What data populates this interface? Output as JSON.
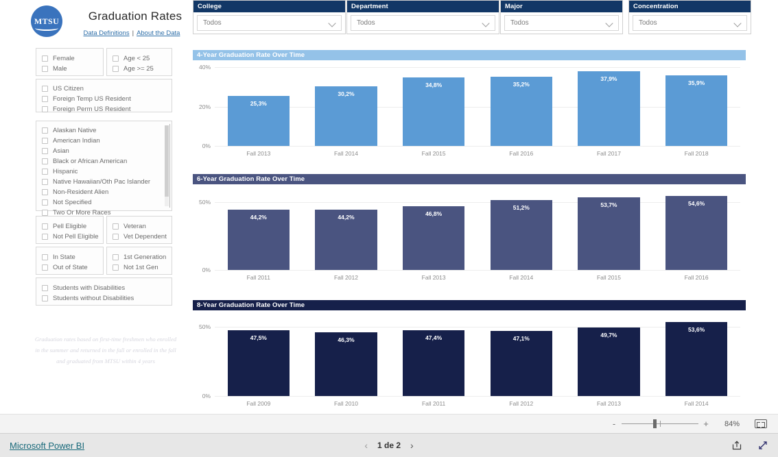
{
  "header": {
    "logo_text": "MTSU",
    "title": "Graduation Rates",
    "link_definitions": "Data Definitions",
    "link_separator": "|",
    "link_about": "About the Data"
  },
  "slicers": {
    "gender": [
      "Female",
      "Male"
    ],
    "age": [
      "Age < 25",
      "Age >= 25"
    ],
    "citizenship": [
      "US Citizen",
      "Foreign Temp US Resident",
      "Foreign Perm US Resident"
    ],
    "race": [
      "Alaskan Native",
      "American Indian",
      "Asian",
      "Black or African American",
      "Hispanic",
      "Native Hawaiian/Oth Pac Islander",
      "Non-Resident Alien",
      "Not Specified",
      "Two Or More Races"
    ],
    "pell": [
      "Pell Eligible",
      "Not Pell Eligible"
    ],
    "veteran": [
      "Veteran",
      "Vet Dependent"
    ],
    "residency": [
      "In State",
      "Out of State"
    ],
    "generation": [
      "1st Generation",
      "Not 1st Gen"
    ],
    "disability": [
      "Students with Disabilities",
      "Students without Disabilities"
    ]
  },
  "footnote": "Graduation rates based on first-time freshmen who enrolled in the summer and returned in the fall or enrolled in the fall and graduated from MTSU within 4 years",
  "dropdowns": [
    {
      "label": "College",
      "value": "Todos"
    },
    {
      "label": "Department",
      "value": "Todos"
    },
    {
      "label": "Major",
      "value": "Todos"
    },
    {
      "label": "Concentration",
      "value": "Todos"
    }
  ],
  "colors": {
    "header_navy": "#123766",
    "chart1_header": "#94c2e8",
    "chart1_bar": "#5b9bd5",
    "chart2_header": "#4a5480",
    "chart2_bar": "#4a5480",
    "chart3_header": "#16204a",
    "chart3_bar": "#16204a",
    "link": "#2d6ea8",
    "pbi_link": "#18697a"
  },
  "chart_data": [
    {
      "type": "bar",
      "title": "4-Year Graduation Rate Over Time",
      "categories": [
        "Fall 2013",
        "Fall 2014",
        "Fall 2015",
        "Fall 2016",
        "Fall 2017",
        "Fall 2018"
      ],
      "values": [
        25.3,
        30.2,
        34.8,
        35.2,
        37.9,
        35.9
      ],
      "labels": [
        "25,3%",
        "30,2%",
        "34,8%",
        "35,2%",
        "37,9%",
        "35,9%"
      ],
      "yticks": [
        "40%",
        "20%",
        "0%"
      ],
      "ylim": [
        0,
        40
      ],
      "xlabel": "",
      "ylabel": "",
      "grid": true,
      "legend": "none",
      "bar_color": "#5b9bd5",
      "header_color": "#94c2e8"
    },
    {
      "type": "bar",
      "title": "6-Year Graduation Rate Over Time",
      "categories": [
        "Fall 2011",
        "Fall 2012",
        "Fall 2013",
        "Fall 2014",
        "Fall 2015",
        "Fall 2016"
      ],
      "values": [
        44.2,
        44.2,
        46.8,
        51.2,
        53.7,
        54.6
      ],
      "labels": [
        "44,2%",
        "44,2%",
        "46,8%",
        "51,2%",
        "53,7%",
        "54,6%"
      ],
      "yticks": [
        "50%",
        "0%"
      ],
      "ylim": [
        0,
        58
      ],
      "xlabel": "",
      "ylabel": "",
      "grid": true,
      "legend": "none",
      "bar_color": "#4a5480",
      "header_color": "#4a5480"
    },
    {
      "type": "bar",
      "title": "8-Year Graduation Rate Over Time",
      "categories": [
        "Fall 2009",
        "Fall 2010",
        "Fall 2011",
        "Fall 2012",
        "Fall 2013",
        "Fall 2014"
      ],
      "values": [
        47.5,
        46.3,
        47.4,
        47.1,
        49.7,
        53.6
      ],
      "labels": [
        "47,5%",
        "46,3%",
        "47,4%",
        "47,1%",
        "49,7%",
        "53,6%"
      ],
      "yticks": [
        "50%",
        "0%"
      ],
      "ylim": [
        0,
        57
      ],
      "xlabel": "",
      "ylabel": "",
      "grid": true,
      "legend": "none",
      "bar_color": "#16204a",
      "header_color": "#16204a"
    }
  ],
  "zoombar": {
    "minus": "-",
    "plus": "+",
    "percent": "84%"
  },
  "statusbar": {
    "brand": "Microsoft Power BI",
    "prev": "‹",
    "page": "1 de 2",
    "next": "›"
  }
}
